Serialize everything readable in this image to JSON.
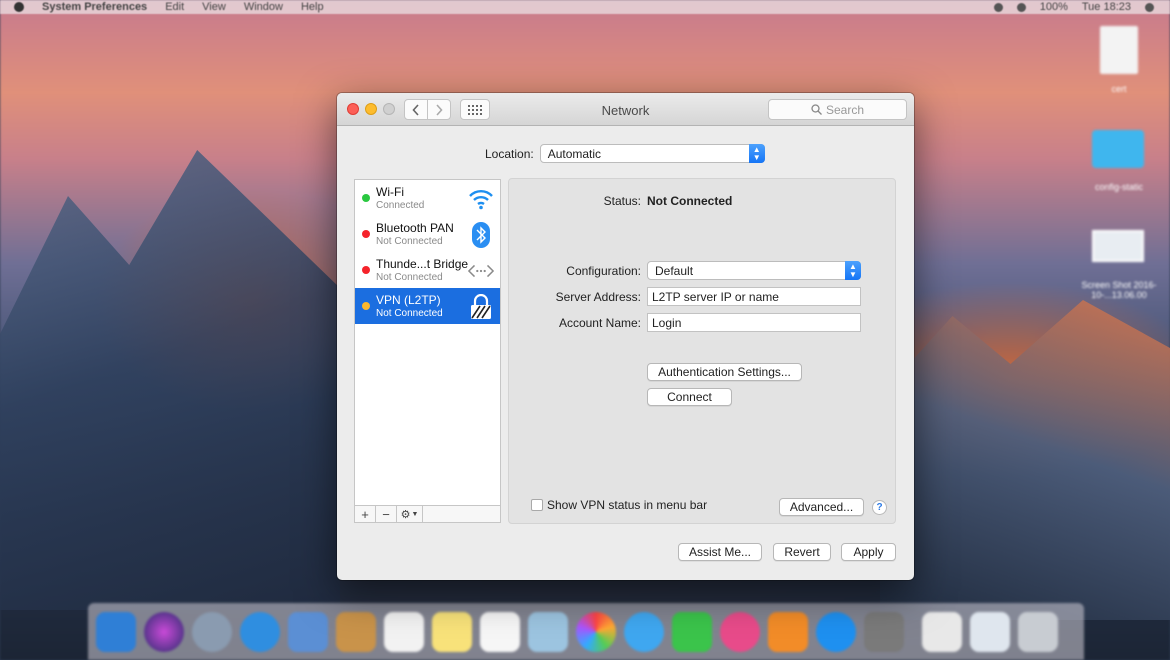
{
  "menubar": {
    "app_name": "System Preferences",
    "items": [
      "Edit",
      "View",
      "Window",
      "Help"
    ],
    "clock": "Tue 18:23",
    "battery": "100%"
  },
  "desktop": {
    "icons": [
      {
        "label": "cert"
      },
      {
        "label": "config-static"
      },
      {
        "label": "Screen Shot 2016-10-...13.06.00"
      }
    ]
  },
  "window": {
    "title": "Network",
    "search_placeholder": "Search"
  },
  "location": {
    "label": "Location:",
    "value": "Automatic"
  },
  "services": [
    {
      "name": "Wi-Fi",
      "status": "Connected",
      "dot_color": "#2ac840",
      "icon": "wifi-icon"
    },
    {
      "name": "Bluetooth PAN",
      "status": "Not Connected",
      "dot_color": "#f5232b",
      "icon": "bluetooth-icon"
    },
    {
      "name": "Thunde...t Bridge",
      "status": "Not Connected",
      "dot_color": "#f5232b",
      "icon": "thunderbolt-bridge-icon"
    },
    {
      "name": "VPN (L2TP)",
      "status": "Not Connected",
      "dot_color": "#fbb72d",
      "icon": "vpn-lock-icon",
      "selected": true
    }
  ],
  "sidebar_tools": {
    "add": "+",
    "remove": "−",
    "gear": "⚙"
  },
  "detail": {
    "status_label": "Status:",
    "status_value": "Not Connected",
    "configuration_label": "Configuration:",
    "configuration_value": "Default",
    "server_label": "Server Address:",
    "server_value": "L2TP server IP or name",
    "account_label": "Account Name:",
    "account_value": "Login",
    "auth_button": "Authentication Settings...",
    "connect_button": "Connect",
    "show_vpn_label": "Show VPN status in menu bar",
    "show_vpn_checked": false,
    "advanced_button": "Advanced...",
    "help": "?"
  },
  "footer": {
    "assist_button": "Assist Me...",
    "revert_button": "Revert",
    "apply_button": "Apply"
  },
  "colors": {
    "selection": "#1b6ee0",
    "accent": "#1575f6"
  }
}
